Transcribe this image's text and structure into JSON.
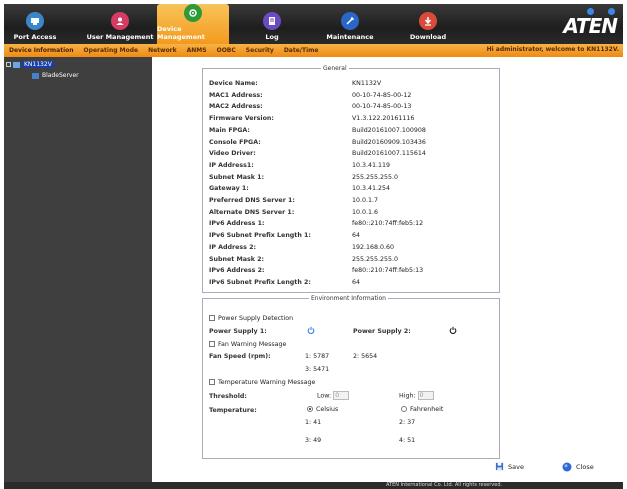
{
  "nav": {
    "items": [
      {
        "label": "Port Access",
        "icon": "port-access-icon",
        "color": "#3b86c8"
      },
      {
        "label": "User Management",
        "icon": "user-management-icon",
        "color": "#d63b64"
      },
      {
        "label": "Device Management",
        "icon": "device-management-icon",
        "color": "#2e9a3a"
      },
      {
        "label": "Log",
        "icon": "log-icon",
        "color": "#6a4bc0"
      },
      {
        "label": "Maintenance",
        "icon": "maintenance-icon",
        "color": "#2a66c8"
      },
      {
        "label": "Download",
        "icon": "download-icon",
        "color": "#d84a3a"
      }
    ],
    "active": "Device Management",
    "logo": "ATEN"
  },
  "subtabs": {
    "items": [
      "Device Information",
      "Operating Mode",
      "Network",
      "ANMS",
      "OOBC",
      "Security",
      "Date/Time"
    ],
    "active": "Device Information",
    "welcome": "Hi administrator, welcome to KN1132V."
  },
  "sidebar": {
    "root": "KN1132V",
    "child": "BladeServer"
  },
  "general": {
    "legend": "General",
    "rows": [
      {
        "label": "Device Name:",
        "value": "KN1132V"
      },
      {
        "label": "MAC1 Address:",
        "value": "00-10-74-85-00-12"
      },
      {
        "label": "MAC2 Address:",
        "value": "00-10-74-85-00-13"
      },
      {
        "label": "Firmware Version:",
        "value": "V1.3.122.20161116"
      },
      {
        "label": "Main FPGA:",
        "value": "Build20161007.100908"
      },
      {
        "label": "Console FPGA:",
        "value": "Build20160909.103436"
      },
      {
        "label": "Video Driver:",
        "value": "Build20161007.115614"
      },
      {
        "label": "IP Address1:",
        "value": "10.3.41.119"
      },
      {
        "label": "Subnet Mask 1:",
        "value": "255.255.255.0"
      },
      {
        "label": "Gateway 1:",
        "value": "10.3.41.254"
      },
      {
        "label": "Preferred DNS Server 1:",
        "value": "10.0.1.7"
      },
      {
        "label": "Alternate DNS Server 1:",
        "value": "10.0.1.6"
      },
      {
        "label": "IPv6 Address 1:",
        "value": "fe80::210:74ff:feb5:12"
      },
      {
        "label": "IPv6 Subnet Prefix Length 1:",
        "value": "64"
      },
      {
        "label": "IP Address 2:",
        "value": "192.168.0.60"
      },
      {
        "label": "Subnet Mask 2:",
        "value": "255.255.255.0"
      },
      {
        "label": "IPv6 Address 2:",
        "value": "fe80::210:74ff:feb5:13"
      },
      {
        "label": "IPv6 Subnet Prefix Length 2:",
        "value": "64"
      }
    ]
  },
  "environment": {
    "legend": "Environment Information",
    "power_detection_label": "Power Supply Detection",
    "power_supply_1_label": "Power Supply 1:",
    "power_supply_2_label": "Power Supply 2:",
    "fan_warning_label": "Fan Warning Message",
    "fan_speed_label": "Fan Speed (rpm):",
    "fan_1": "1: 5787",
    "fan_2": "2: 5654",
    "fan_3": "3: 5471",
    "temp_warning_label": "Temperature Warning Message",
    "threshold_label": "Threshold:",
    "low_label": "Low:",
    "low_value": "0",
    "high_label": "High:",
    "high_value": "0",
    "temperature_label": "Temperature:",
    "celsius_label": "Celsius",
    "fahrenheit_label": "Fahrenheit",
    "temp_1": "1: 41",
    "temp_2": "2: 37",
    "temp_3": "3: 49",
    "temp_4": "4: 51"
  },
  "actions": {
    "save_label": "Save",
    "close_label": "Close"
  },
  "footer": {
    "text": "ATEN International Co. Ltd. All rights reserved."
  }
}
